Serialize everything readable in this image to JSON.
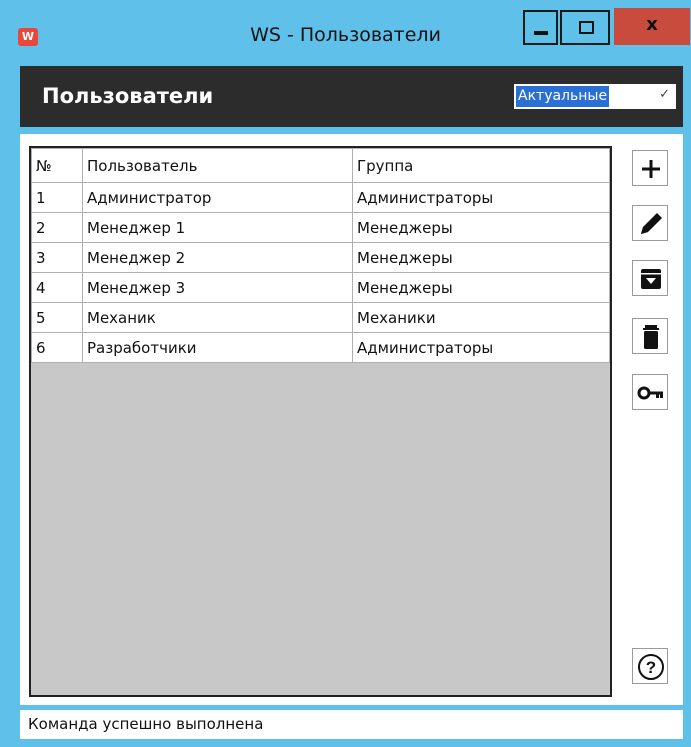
{
  "window": {
    "title": "WS - Пользователи",
    "app_icon_text": "W",
    "close_label": "x",
    "accent_color": "#5fc0ea",
    "close_color": "#c94b3d"
  },
  "header": {
    "title": "Пользователи",
    "filter": {
      "selected": "Актуальные"
    }
  },
  "table": {
    "columns": [
      "№",
      "Пользователь",
      "Группа"
    ],
    "rows": [
      [
        "1",
        "Администратор",
        "Администраторы"
      ],
      [
        "2",
        "Менеджер 1",
        "Менеджеры"
      ],
      [
        "3",
        "Менеджер 2",
        "Менеджеры"
      ],
      [
        "4",
        "Менеджер 3",
        "Менеджеры"
      ],
      [
        "5",
        "Механик",
        "Механики"
      ],
      [
        "6",
        "Разработчики",
        "Администраторы"
      ]
    ]
  },
  "actions": [
    "plus-icon",
    "pencil-icon",
    "archive-icon",
    "trash-icon",
    "key-icon",
    "help-icon"
  ],
  "status": {
    "text": "Команда успешно выполнена"
  }
}
